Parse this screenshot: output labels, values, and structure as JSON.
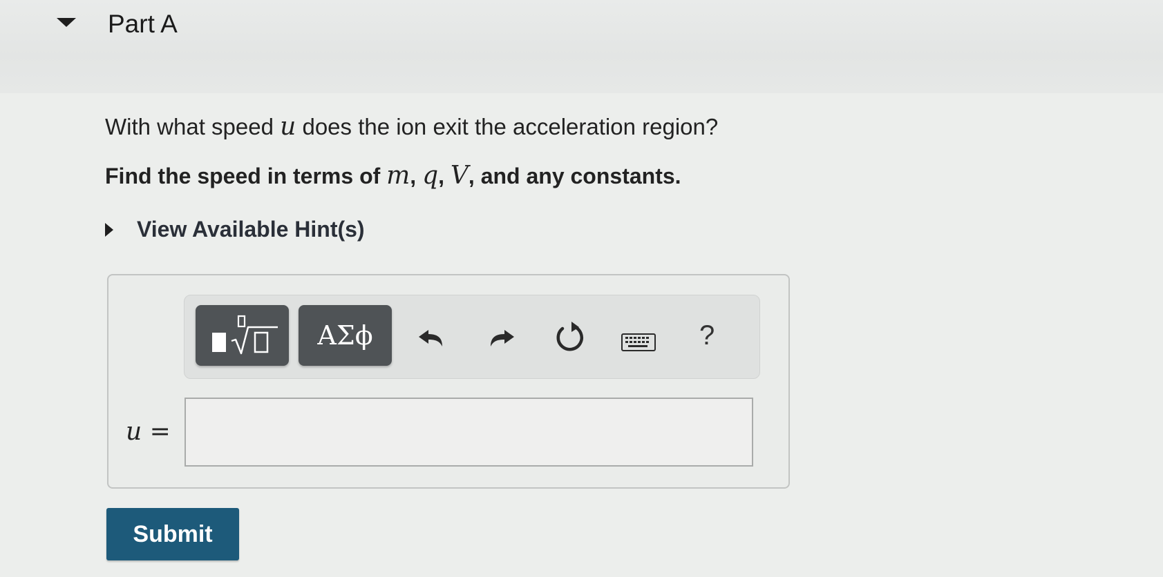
{
  "part": {
    "title": "Part A"
  },
  "question": {
    "text_before": "With what speed ",
    "variable": "u",
    "text_after": " does the ion exit the acceleration region?"
  },
  "instruction": {
    "text_before": "Find the speed in terms of ",
    "var_m": "m",
    "sep1": ", ",
    "var_q": "q",
    "sep2": ", ",
    "var_V": "V",
    "text_after": ", and any constants."
  },
  "hints": {
    "label": "View Available Hint(s)"
  },
  "toolbar": {
    "templates_icon": "templates-root-icon",
    "greek_label": "ΑΣϕ",
    "undo_icon": "undo-icon",
    "redo_icon": "redo-icon",
    "reset_icon": "reset-icon",
    "keyboard_icon": "keyboard-icon",
    "help_label": "?"
  },
  "answer": {
    "label": "u =",
    "value": "",
    "placeholder": ""
  },
  "submit": {
    "label": "Submit",
    "color": "#1d5a7a"
  }
}
